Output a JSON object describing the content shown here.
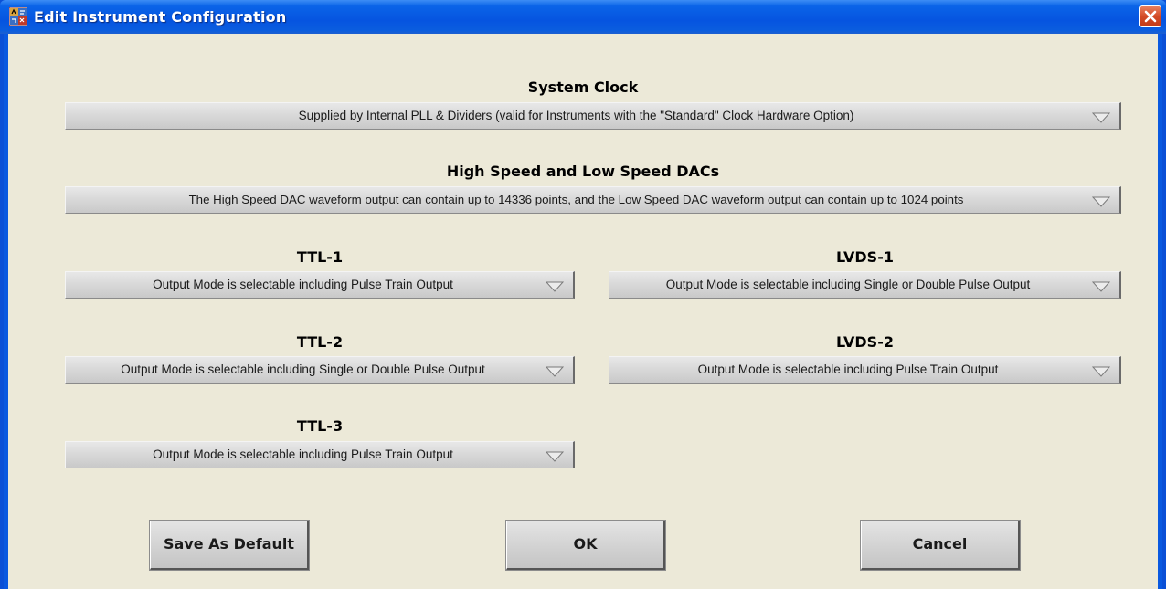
{
  "window": {
    "title": "Edit Instrument Configuration",
    "icon": "app-icon",
    "close_icon": "close-icon"
  },
  "system_clock": {
    "label": "System Clock",
    "selected": "Supplied by Internal PLL & Dividers (valid for Instruments with the \"Standard\" Clock Hardware Option)"
  },
  "dacs": {
    "label": "High Speed and Low Speed DACs",
    "selected": "The High Speed DAC waveform output can contain up to 14336 points, and the Low Speed DAC waveform output can contain up to 1024 points"
  },
  "ttl1": {
    "label": "TTL-1",
    "selected": "Output Mode is selectable including Pulse Train Output"
  },
  "lvds1": {
    "label": "LVDS-1",
    "selected": "Output Mode is selectable including Single or Double Pulse Output"
  },
  "ttl2": {
    "label": "TTL-2",
    "selected": "Output Mode is selectable including Single or Double Pulse Output"
  },
  "lvds2": {
    "label": "LVDS-2",
    "selected": "Output Mode is selectable including Pulse Train Output"
  },
  "ttl3": {
    "label": "TTL-3",
    "selected": "Output Mode is selectable including Pulse Train Output"
  },
  "buttons": {
    "save_default": "Save As Default",
    "ok": "OK",
    "cancel": "Cancel"
  },
  "colors": {
    "title_bar": "#0a5ddf",
    "client_bg": "#ece9d8",
    "close_button": "#d34a25"
  }
}
